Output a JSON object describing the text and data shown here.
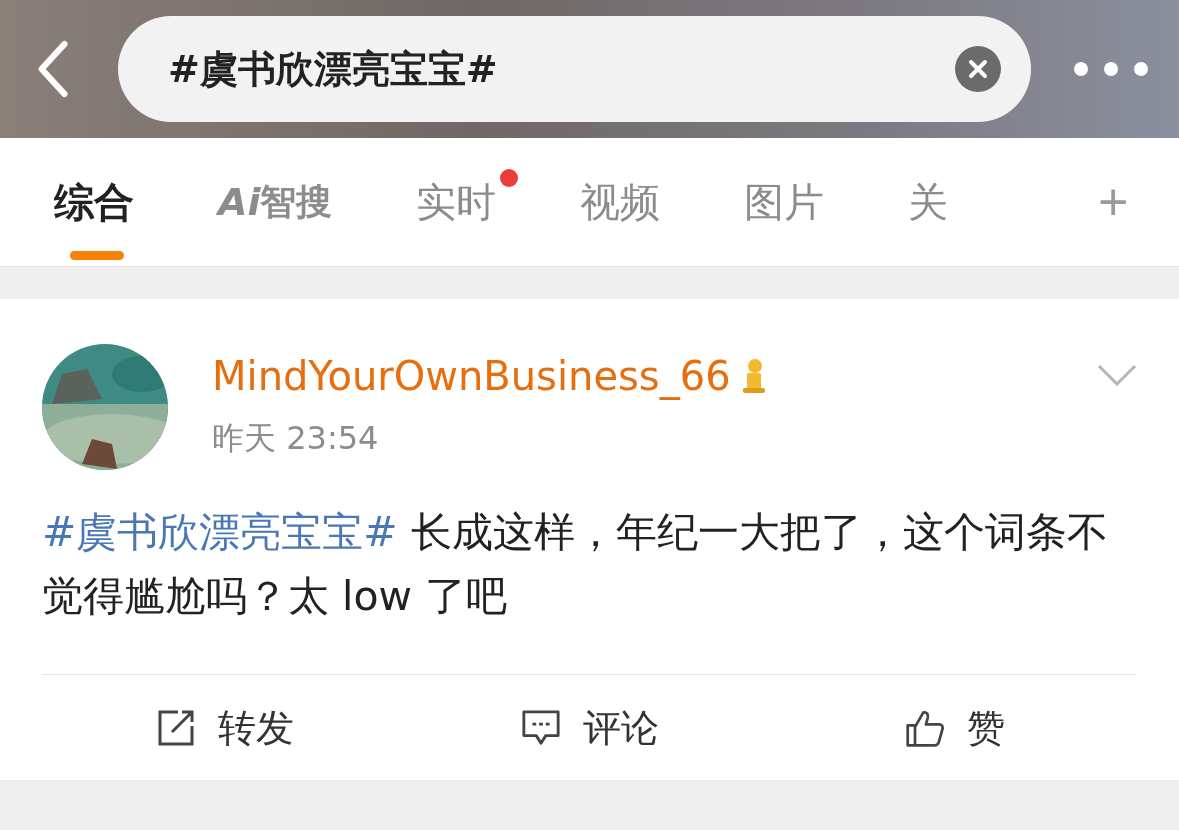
{
  "search": {
    "value": "#虞书欣漂亮宝宝#"
  },
  "tabs": [
    {
      "label": "综合",
      "kind": "text",
      "selected": true,
      "badge": false
    },
    {
      "label": "智搜",
      "logo": "Ai",
      "kind": "ai",
      "selected": false,
      "badge": false
    },
    {
      "label": "实时",
      "kind": "text",
      "selected": false,
      "badge": true
    },
    {
      "label": "视频",
      "kind": "text",
      "selected": false,
      "badge": false
    },
    {
      "label": "图片",
      "kind": "text",
      "selected": false,
      "badge": false
    },
    {
      "label": "关",
      "kind": "text",
      "selected": false,
      "badge": false
    }
  ],
  "add_tab": "+",
  "post": {
    "username": "MindYourOwnBusiness_66",
    "time": "昨天 23:54",
    "hashtag": "#虞书欣漂亮宝宝#",
    "text": " 长成这样，年纪一大把了，这个词条不觉得尴尬吗？太 low 了吧",
    "actions": [
      {
        "kind": "repost",
        "label": "转发"
      },
      {
        "kind": "comment",
        "label": "评论"
      },
      {
        "kind": "like",
        "label": "赞"
      }
    ]
  }
}
